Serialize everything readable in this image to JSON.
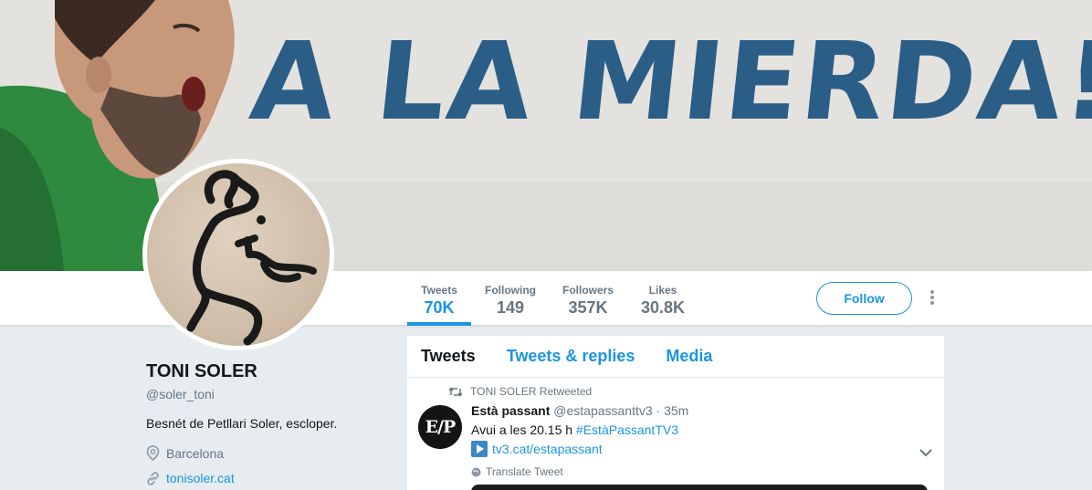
{
  "banner": {
    "graffiti_text": "A LA MIERDA!",
    "graffiti_color": "#17507e"
  },
  "profile": {
    "name": "TONI SOLER",
    "handle": "@soler_toni",
    "bio": "Besnét de Petllari Soler, escloper.",
    "location": "Barcelona",
    "website": "tonisoler.cat"
  },
  "stats": [
    {
      "label": "Tweets",
      "value": "70K",
      "active": true
    },
    {
      "label": "Following",
      "value": "149",
      "active": false
    },
    {
      "label": "Followers",
      "value": "357K",
      "active": false
    },
    {
      "label": "Likes",
      "value": "30.8K",
      "active": false
    }
  ],
  "actions": {
    "follow_label": "Follow"
  },
  "timeline": {
    "tabs": [
      {
        "label": "Tweets",
        "active": true
      },
      {
        "label": "Tweets & replies",
        "active": false
      },
      {
        "label": "Media",
        "active": false
      }
    ],
    "tweet": {
      "retweeted_by": "TONI SOLER Retweeted",
      "avatar_text": "E/P",
      "author_name": "Està passant",
      "author_handle": "@estapassanttv3",
      "time": "· 35m",
      "text": "Avui a les 20.15 h ",
      "hashtag": "#EstàPassantTV3",
      "link": "tv3.cat/estapassant",
      "translate_label": "Translate Tweet"
    }
  },
  "colors": {
    "accent": "#1b95e0",
    "background": "#e6ecf0",
    "secondary_text": "#657786"
  }
}
